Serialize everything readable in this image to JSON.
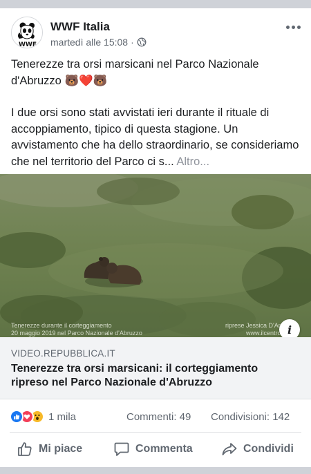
{
  "post": {
    "page_name": "WWF Italia",
    "timestamp": "martedì alle 15:08",
    "separator": "·",
    "text_line1": "Tenerezze tra orsi marsicani nel Parco Nazionale d'Abruzzo 🐻❤️🐻",
    "text_body": "I due orsi sono stati avvistati ieri durante il rituale di accoppiamento, tipico di questa stagione. Un avvistamento che ha dello straordinario, se consideriamo che nel territorio del Parco ci s...",
    "see_more": "Altro..."
  },
  "media": {
    "caption_left_1": "Tenerezze durante il corteggiamento",
    "caption_left_2": "20 maggio 2019 nel Parco Nazionale d'Abruzzo",
    "caption_right_1": "riprese Jessica D'Andrea",
    "caption_right_2": "www.ilcentro.it"
  },
  "link": {
    "domain": "VIDEO.REPUBBLICA.IT",
    "title": "Tenerezze tra orsi marsicani: il corteggiamento ripreso nel Parco Nazionale d'Abruzzo"
  },
  "stats": {
    "reactions_count": "1 mila",
    "comments": "Commenti: 49",
    "shares": "Condivisioni: 142"
  },
  "actions": {
    "like": "Mi piace",
    "comment": "Commenta",
    "share": "Condividi"
  },
  "icons": [
    "wwf-logo",
    "globe-icon",
    "more-icon",
    "info-icon",
    "like-reaction-icon",
    "love-reaction-icon",
    "wow-reaction-icon",
    "thumbs-up-icon",
    "comment-icon",
    "share-icon"
  ],
  "colors": {
    "like_blue": "#1877f2",
    "love_red": "#f33e58",
    "wow_yellow": "#f7b928",
    "secondary_text": "#606770"
  }
}
